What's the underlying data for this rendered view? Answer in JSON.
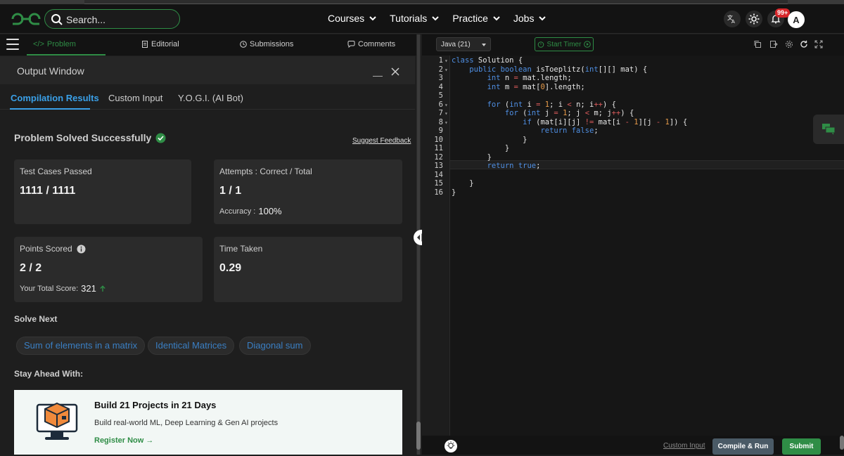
{
  "nav": {
    "search_placeholder": "Search...",
    "links": [
      "Courses",
      "Tutorials",
      "Practice",
      "Jobs"
    ],
    "notif_badge": "99+",
    "avatar_letter": "A"
  },
  "left_tabs": {
    "problem": "Problem",
    "editorial": "Editorial",
    "submissions": "Submissions",
    "comments": "Comments"
  },
  "output": {
    "title": "Output Window",
    "tabs": [
      "Compilation Results",
      "Custom Input",
      "Y.O.G.I. (AI Bot)"
    ],
    "status": "Problem Solved Successfully",
    "suggest_feedback": "Suggest Feedback",
    "test_cases_label": "Test Cases Passed",
    "test_cases_value": "1111 / 1111",
    "attempts_label": "Attempts : Correct / Total",
    "attempts_value": "1 / 1",
    "accuracy_label": "Accuracy :",
    "accuracy_value": "100%",
    "points_label": "Points Scored",
    "points_value": "2 / 2",
    "total_score_label": "Your Total Score:",
    "total_score_value": "321",
    "time_label": "Time Taken",
    "time_value": "0.29",
    "solve_next_label": "Solve Next",
    "solve_next": [
      "Sum of elements in a matrix",
      "Identical Matrices",
      "Diagonal sum"
    ],
    "stay_ahead_label": "Stay Ahead With:",
    "promo_title": "Build 21 Projects in 21 Days",
    "promo_desc": "Build real-world ML, Deep Learning & Gen AI projects",
    "promo_cta": "Register Now →"
  },
  "editor": {
    "language": "Java (21)",
    "timer_label": "Start Timer",
    "custom_input": "Custom Input",
    "compile_run": "Compile & Run",
    "submit": "Submit",
    "line_numbers": [
      "1",
      "2",
      "3",
      "4",
      "5",
      "6",
      "7",
      "8",
      "9",
      "10",
      "11",
      "12",
      "13",
      "14",
      "15",
      "16"
    ]
  },
  "colors": {
    "brand_green": "#2f8d46",
    "accent_blue": "#3aa0e8",
    "keyword_blue": "#4f8fe3",
    "number_orange": "#e79b4a"
  }
}
